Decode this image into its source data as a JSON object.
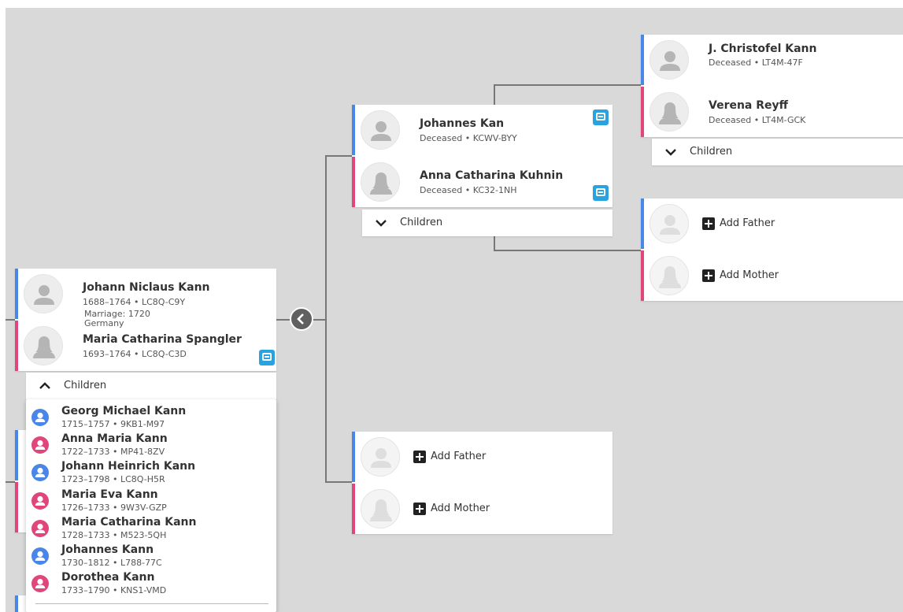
{
  "colors": {
    "canvas_bg": "#d9d9d9",
    "male": "#4a86e8",
    "female": "#e0457b",
    "record_badge": "#29a3e0",
    "connector": "#777777"
  },
  "focus_couple": {
    "husband": {
      "name": "Johann Niclaus Kann",
      "meta": "1688–1764 • LC8Q-C9Y"
    },
    "marriage": {
      "date": "Marriage: 1720",
      "place": "Germany"
    },
    "wife": {
      "name": "Maria Catharina Spangler",
      "meta": "1693–1764 • LC8Q-C3D"
    },
    "children_toggle": {
      "label": "Children",
      "state": "expanded"
    }
  },
  "children_list": [
    {
      "name": "Georg Michael Kann",
      "meta": "1715–1757 • 9KB1-M97",
      "sex": "male"
    },
    {
      "name": "Anna Maria Kann",
      "meta": "1722–1733 • MP41-8ZV",
      "sex": "female"
    },
    {
      "name": "Johann Heinrich Kann",
      "meta": "1723–1798 • LC8Q-H5R",
      "sex": "male"
    },
    {
      "name": "Maria Eva Kann",
      "meta": "1726–1733 • 9W3V-GZP",
      "sex": "female"
    },
    {
      "name": "Maria Catharina Kann",
      "meta": "1728–1733 • M523-5QH",
      "sex": "female"
    },
    {
      "name": "Johannes Kann",
      "meta": "1730–1812 • L788-77C",
      "sex": "male"
    },
    {
      "name": "Dorothea Kann",
      "meta": "1733–1790 • KNS1-VMD",
      "sex": "female"
    }
  ],
  "paternal_parents": {
    "father": {
      "name": "Johannes Kan",
      "meta": "Deceased • KCWV-BYY"
    },
    "mother": {
      "name": "Anna Catharina Kuhnin",
      "meta": "Deceased • KC32-1NH"
    },
    "children_toggle": {
      "label": "Children",
      "state": "collapsed"
    }
  },
  "paternal_grandparents": {
    "father": {
      "name": "J. Christofel Kann",
      "meta": "Deceased • LT4M-47F"
    },
    "mother": {
      "name": "Verena Reyff",
      "meta": "Deceased • LT4M-GCK"
    },
    "children_toggle": {
      "label": "Children",
      "state": "collapsed"
    }
  },
  "paternal_maternal_grandparents": {
    "add_father": "Add Father",
    "add_mother": "Add Mother"
  },
  "maternal_parents": {
    "add_father": "Add Father",
    "add_mother": "Add Mother"
  }
}
